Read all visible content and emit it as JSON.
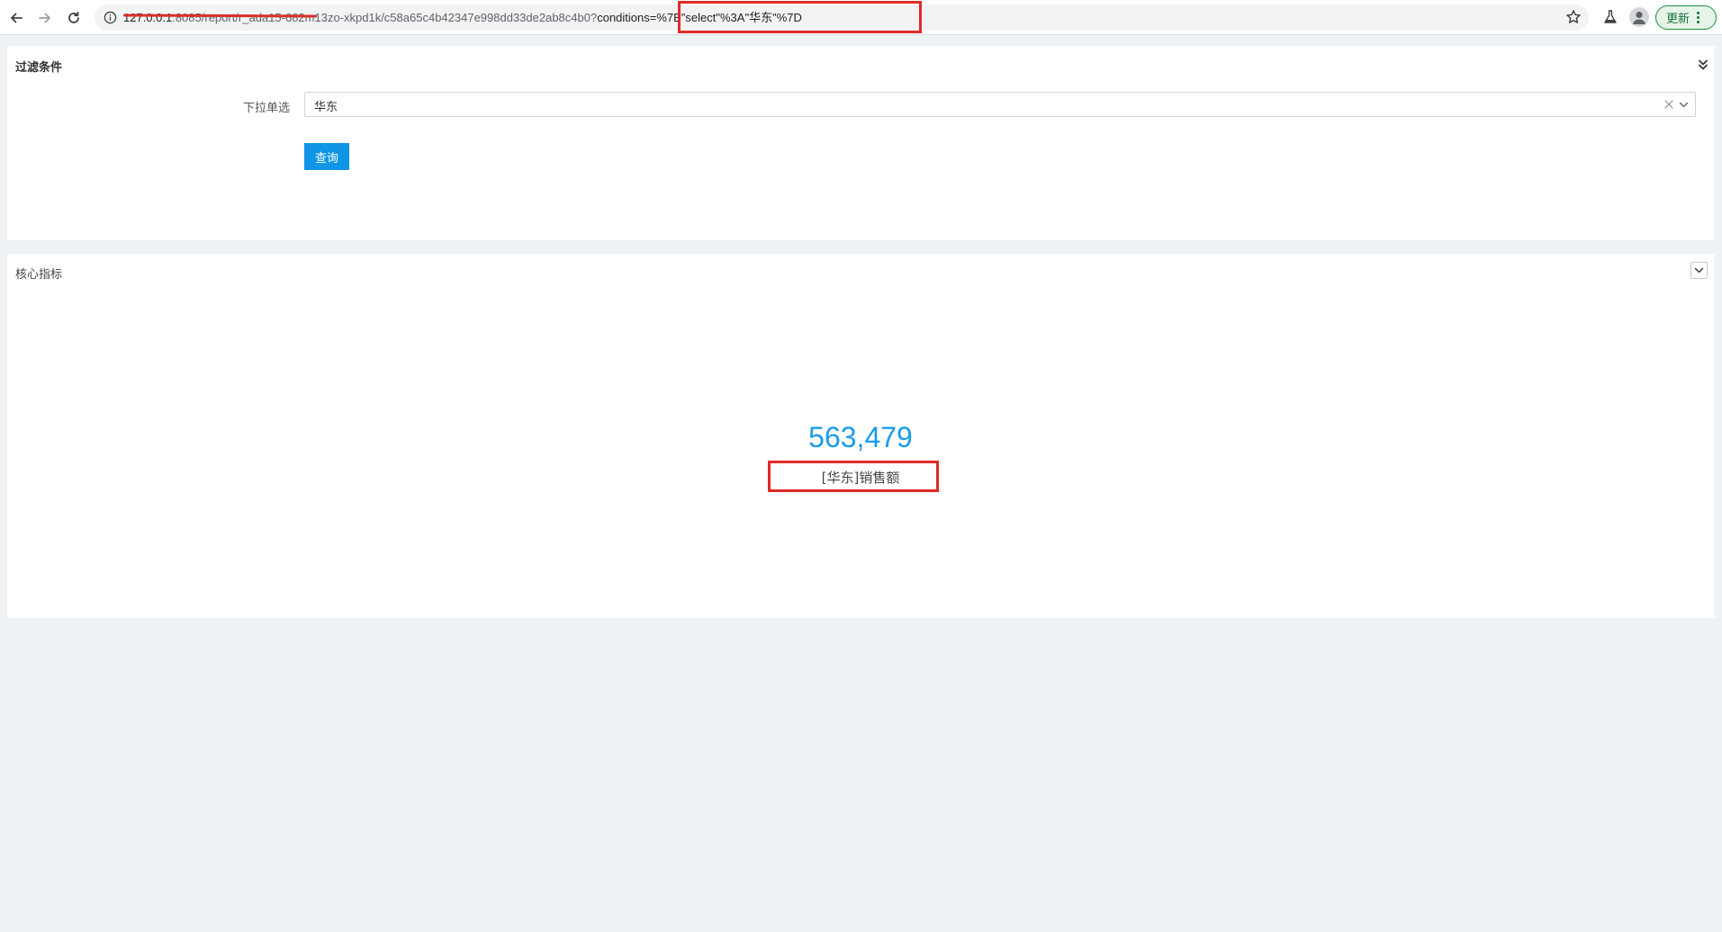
{
  "browser": {
    "url": {
      "host": "127.0.0.1",
      "path": ":8085/report/r_ada15-682m13zo-xkpd1k/c58a65c4b42347e998dd33de2ab8c4b0?",
      "query": "conditions=%7B\"select\"%3A\"华东\"%7D"
    },
    "update_label": "更新",
    "icons": {
      "back": "arrow-left-icon",
      "forward": "arrow-right-icon",
      "reload": "reload-icon",
      "info": "info-icon",
      "bookmark": "star-icon",
      "extension": "flask-icon",
      "profile": "user-icon"
    }
  },
  "filter": {
    "title": "过滤条件",
    "select_label": "下拉单选",
    "select_value": "华东",
    "query_label": "查询"
  },
  "metric": {
    "title": "核心指标",
    "value": "563,479",
    "label": "[华东]销售额"
  },
  "colors": {
    "accent": "#0f95e6",
    "metric_value": "#1a9bea",
    "highlight": "#e12a26",
    "page_bg": "#eff2f4"
  }
}
